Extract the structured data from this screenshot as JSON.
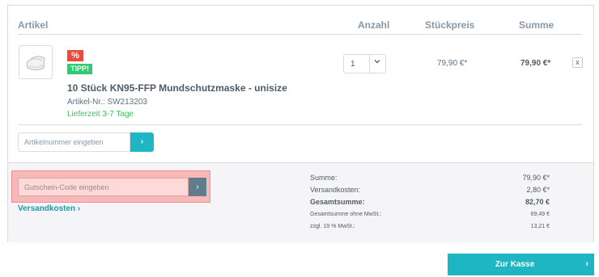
{
  "table": {
    "headers": {
      "article": "Artikel",
      "quantity": "Anzahl",
      "unit_price": "Stückpreis",
      "sum": "Summe"
    }
  },
  "product": {
    "badge_percent": "%",
    "badge_tip": "TIPP!",
    "name": "10 Stück KN95-FFP Mundschutzmaske - unisize",
    "article_number": "Artikel-Nr.: SW213203",
    "delivery_time": "Lieferzeit 3-7 Tage",
    "quantity": "1",
    "unit_price": "79,90 €*",
    "total": "79,90 €*",
    "remove_label": "x"
  },
  "add_article": {
    "placeholder": "Artikelnummer eingeben",
    "button_label": "›"
  },
  "coupon": {
    "placeholder": "Gutschein-Code eingeben",
    "button_label": "›"
  },
  "shipping_link": "Versandkosten ›",
  "summary": {
    "rows": [
      {
        "label": "Summe:",
        "value": "79,90 €*"
      },
      {
        "label": "Versandkosten:",
        "value": "2,80 €*"
      },
      {
        "label": "Gesamtsumme:",
        "value": "82,70 €"
      },
      {
        "label": "Gesamtsumme ohne MwSt.:",
        "value": "69,49 €"
      },
      {
        "label": "zzgl. 19 % MwSt.:",
        "value": "13,21 €"
      }
    ]
  },
  "checkout": {
    "label": "Zur Kasse",
    "arrow": "›"
  },
  "colors": {
    "accent": "#1fb6c4",
    "sale_red": "#e74c3c",
    "tip_green": "#2ecc71",
    "highlight": "#f6b8b8"
  }
}
